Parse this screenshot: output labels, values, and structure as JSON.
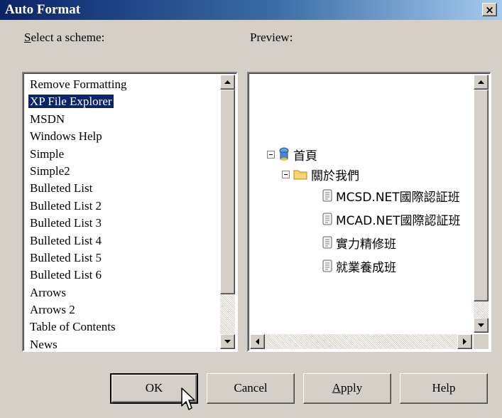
{
  "window": {
    "title": "Auto Format",
    "close_glyph": "×"
  },
  "labels": {
    "scheme_prefix": "S",
    "scheme_rest": "elect a scheme:",
    "preview": "Preview:"
  },
  "schemes": [
    "Remove Formatting",
    "XP File Explorer",
    "MSDN",
    "Windows Help",
    "Simple",
    "Simple2",
    "Bulleted List",
    "Bulleted List 2",
    "Bulleted List 3",
    "Bulleted List 4",
    "Bulleted List 5",
    "Bulleted List 6",
    "Arrows",
    "Arrows 2",
    "Table of Contents",
    "News"
  ],
  "selected_index": 1,
  "preview_tree": {
    "root": "首頁",
    "folder": "關於我們",
    "pages": [
      "MCSD.NET國際認証班",
      "MCAD.NET國際認証班",
      "實力精修班",
      "就業養成班"
    ]
  },
  "buttons": {
    "ok": "OK",
    "cancel": "Cancel",
    "apply_prefix": "A",
    "apply_rest": "pply",
    "help": "Help"
  },
  "colors": {
    "selection": "#0a246a",
    "dialog_bg": "#d4d0c8"
  }
}
